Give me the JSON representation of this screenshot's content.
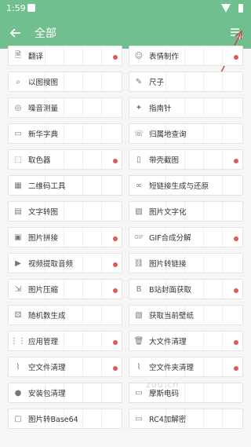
{
  "status": {
    "time": "1:59"
  },
  "appbar": {
    "title": "全部"
  },
  "colors": {
    "accent": "#71bf8f",
    "dot": "#e05a56"
  },
  "items": [
    {
      "label": "翻译",
      "icon": "translate-icon",
      "dot": true
    },
    {
      "label": "表情制作",
      "icon": "smile-icon",
      "dot": true
    },
    {
      "label": "以图搜图",
      "icon": "image-search-icon",
      "dot": false
    },
    {
      "label": "尺子",
      "icon": "ruler-icon",
      "dot": false
    },
    {
      "label": "噪音测量",
      "icon": "noise-icon",
      "dot": false
    },
    {
      "label": "指南针",
      "icon": "compass-icon",
      "dot": false
    },
    {
      "label": "新华字典",
      "icon": "book-icon",
      "dot": false
    },
    {
      "label": "归属地查询",
      "icon": "phone-icon",
      "dot": false
    },
    {
      "label": "取色器",
      "icon": "color-picker-icon",
      "dot": true
    },
    {
      "label": "带壳截图",
      "icon": "phone-frame-icon",
      "dot": true
    },
    {
      "label": "二维码工具",
      "icon": "qrcode-icon",
      "dot": false
    },
    {
      "label": "短链接生成与还原",
      "icon": "link-icon",
      "dot": false
    },
    {
      "label": "文字转图",
      "icon": "text-image-icon",
      "dot": false
    },
    {
      "label": "图片文字化",
      "icon": "image-text-icon",
      "dot": false
    },
    {
      "label": "图片拼接",
      "icon": "image-icon",
      "dot": true
    },
    {
      "label": "GIF合成分解",
      "icon": "gif-icon",
      "dot": true
    },
    {
      "label": "视频提取音频",
      "icon": "video-audio-icon",
      "dot": true
    },
    {
      "label": "图片转链接",
      "icon": "image-link-icon",
      "dot": false
    },
    {
      "label": "图片压缩",
      "icon": "compress-icon",
      "dot": true
    },
    {
      "label": "B站封面获取",
      "icon": "bilibili-icon",
      "dot": true
    },
    {
      "label": "随机数生成",
      "icon": "dice-icon",
      "dot": false
    },
    {
      "label": "获取当前壁纸",
      "icon": "wallpaper-icon",
      "dot": false
    },
    {
      "label": "应用管理",
      "icon": "apps-icon",
      "dot": true
    },
    {
      "label": "大文件清理",
      "icon": "trash-icon",
      "dot": true
    },
    {
      "label": "空文件清理",
      "icon": "broom-icon",
      "dot": true
    },
    {
      "label": "空文件夹清理",
      "icon": "broom-folder-icon",
      "dot": true
    },
    {
      "label": "安装包清理",
      "icon": "package-icon",
      "dot": false
    },
    {
      "label": "摩斯电码",
      "icon": "morse-icon",
      "dot": false
    },
    {
      "label": "图片转Base64",
      "icon": "base64-icon",
      "dot": false
    },
    {
      "label": "RC4加解密",
      "icon": "lock-icon",
      "dot": false
    }
  ]
}
